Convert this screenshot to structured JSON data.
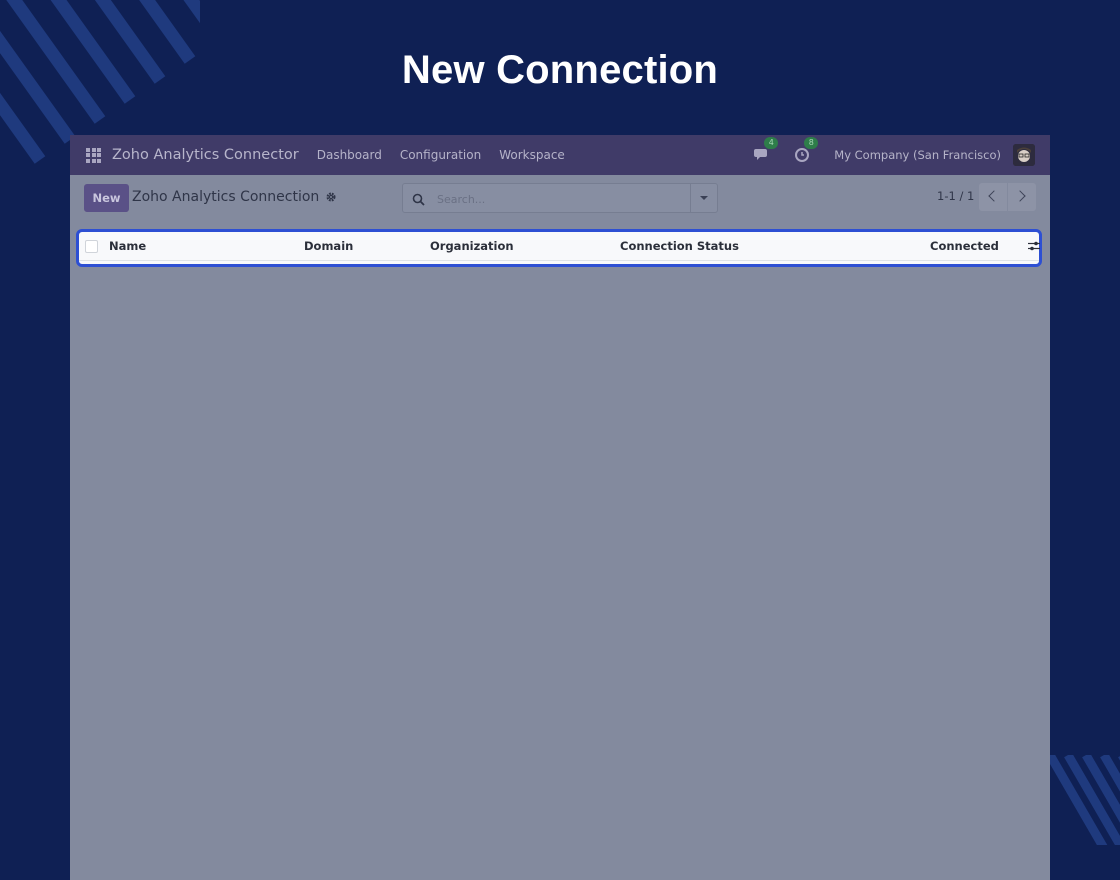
{
  "hero": {
    "title": "New Connection"
  },
  "navbar": {
    "brand": "Zoho Analytics Connector",
    "menu": [
      "Dashboard",
      "Configuration",
      "Workspace"
    ],
    "messages_badge": "4",
    "activities_badge": "8",
    "company": "My Company (San Francisco)"
  },
  "control_panel": {
    "new_label": "New",
    "breadcrumb": "Zoho Analytics Connection",
    "search_placeholder": "Search...",
    "pager_value": "1-1 / 1"
  },
  "list": {
    "columns": [
      "Name",
      "Domain",
      "Organization",
      "Connection Status",
      "Connected"
    ]
  },
  "colors": {
    "page_background": "#0f2054",
    "navbar": "#403b68",
    "primary_button": "#5a5187",
    "overlay": "#838a9e",
    "highlight_border": "#2d4fd3",
    "badge": "#2e7d4a"
  },
  "icons": [
    "apps-icon",
    "gear-icon",
    "search-icon",
    "caret-down-icon",
    "chevron-left-icon",
    "chevron-right-icon",
    "chat-icon",
    "clock-icon",
    "optional-columns-icon"
  ]
}
